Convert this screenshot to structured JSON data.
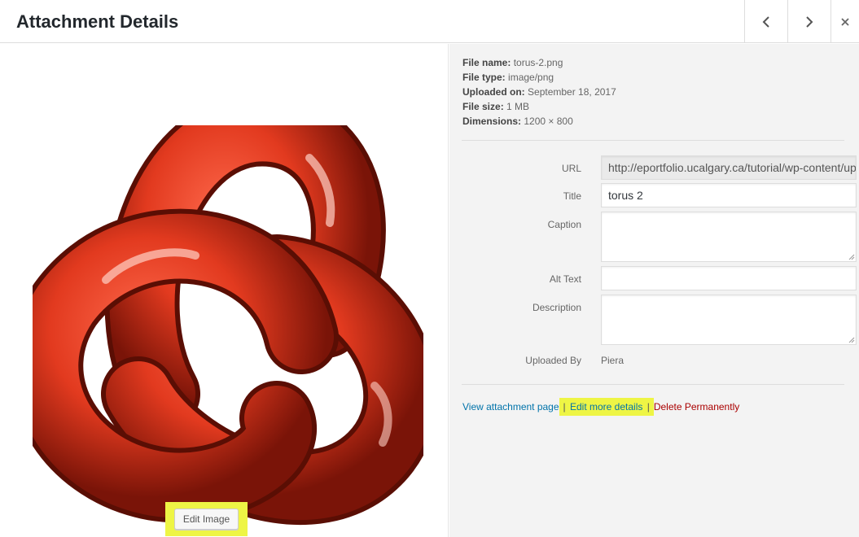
{
  "header": {
    "title": "Attachment Details"
  },
  "nav": {
    "prev_icon": "chevron-left-icon",
    "next_icon": "chevron-right-icon",
    "close_icon": "close-icon"
  },
  "file_info": {
    "name_label": "File name:",
    "name": "torus-2.png",
    "type_label": "File type:",
    "type": "image/png",
    "uploaded_label": "Uploaded on:",
    "uploaded": "September 18, 2017",
    "size_label": "File size:",
    "size": "1 MB",
    "dimensions_label": "Dimensions:",
    "dimensions": "1200 × 800"
  },
  "fields": {
    "url_label": "URL",
    "url_value": "http://eportfolio.ucalgary.ca/tutorial/wp-content/uploads/",
    "title_label": "Title",
    "title_value": "torus 2",
    "caption_label": "Caption",
    "caption_value": "",
    "alt_label": "Alt Text",
    "alt_value": "",
    "description_label": "Description",
    "description_value": "",
    "uploaded_by_label": "Uploaded By",
    "uploaded_by_value": "Piera"
  },
  "links": {
    "view_attachment": "View attachment page",
    "separator": "|",
    "edit_more": "Edit more details",
    "delete": "Delete Permanently"
  },
  "edit_image_label": "Edit Image",
  "colors": {
    "highlight": "#eef545",
    "torus": "#e8432a",
    "link": "#0073aa",
    "danger": "#a00000"
  }
}
